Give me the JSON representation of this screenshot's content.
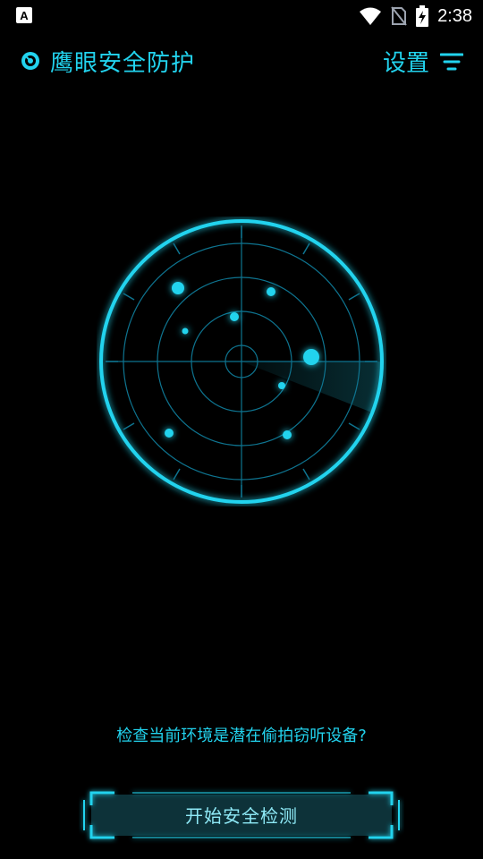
{
  "status_bar": {
    "time": "2:38",
    "icons": [
      "text-a-icon",
      "wifi-icon",
      "no-sim-icon",
      "battery-charging-icon"
    ]
  },
  "header": {
    "app_title": "鹰眼安全防护",
    "settings_label": "设置",
    "logo_icon": "eye-target-icon",
    "menu_icon": "filter-menu-icon"
  },
  "main": {
    "prompt": "检查当前环境是潜在偷拍窃听设备?",
    "start_button_label": "开始安全检测"
  },
  "colors": {
    "accent": "#22d3ee",
    "background": "#000000"
  }
}
